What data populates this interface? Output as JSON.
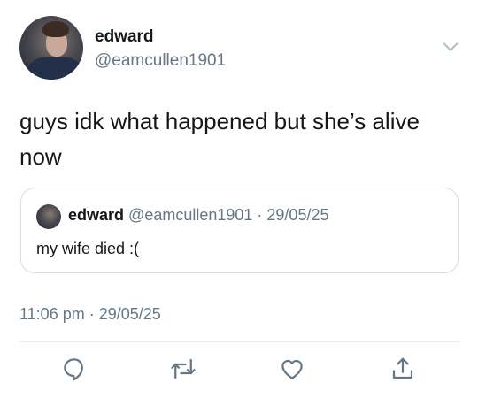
{
  "tweet": {
    "author": {
      "display_name": "edward",
      "handle": "@eamcullen1901"
    },
    "text": "guys idk what happened but she’s alive now",
    "timestamp": "11:06 pm · 29/05/25"
  },
  "quoted_tweet": {
    "display_name": "edward",
    "handle_date": "@eamcullen1901 · 29/05/25",
    "text": "my wife died :("
  },
  "icons": {
    "options": "chevron-down-icon",
    "reply": "reply-icon",
    "retweet": "retweet-icon",
    "like": "heart-icon",
    "share": "share-icon"
  },
  "colors": {
    "icon_gray": "#657786",
    "divider": "#e6ecf0"
  }
}
